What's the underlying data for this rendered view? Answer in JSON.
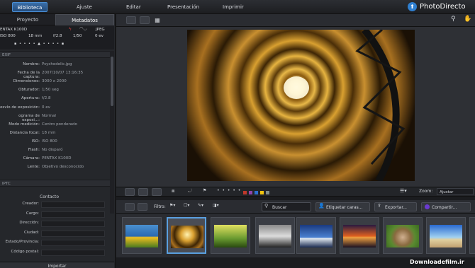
{
  "menu": {
    "biblioteca": "Biblioteca",
    "ajuste": "Ajuste",
    "editar": "Editar",
    "presentacion": "Presentación",
    "imprimir": "Imprimir"
  },
  "brand": {
    "name": "PhotoDirecto"
  },
  "left": {
    "tabs": {
      "proyecto": "Proyecto",
      "metadatos": "Metadatos"
    },
    "exifbar": {
      "camera": "ENTAX K100D",
      "format": "JPEG",
      "iso": "ISO 800",
      "focal": "18 mm",
      "aperture": "f/2.8",
      "shutter": "1/50",
      "ev": "0 ev"
    },
    "exif_title": "EXIF",
    "exif": [
      {
        "k": "Nombre:",
        "v": "Psychedelic.jpg"
      },
      {
        "k": "Fecha de la captura:",
        "v": "2007/10/07 13:16:35"
      },
      {
        "k": "Dimensiones:",
        "v": "3000 x 2000"
      },
      {
        "k": "Obturador:",
        "v": "1/50 seg"
      },
      {
        "k": "Apertura:",
        "v": "f/2.8"
      },
      {
        "k": "esvío de exposición:",
        "v": "0 ev"
      },
      {
        "k": "ograma de exposi...:",
        "v": "Normal"
      },
      {
        "k": "Modo medición:",
        "v": "Centro ponderado"
      },
      {
        "k": "Distancia focal:",
        "v": "18 mm"
      },
      {
        "k": "ISO:",
        "v": "ISO 800"
      },
      {
        "k": "Flash:",
        "v": "No disparó"
      },
      {
        "k": "Cámara:",
        "v": "PENTAX K100D"
      },
      {
        "k": "Lente:",
        "v": "Objetivo desconocido"
      }
    ],
    "iptc_title": "IPTC",
    "contacto": "Contacto",
    "iptc": [
      "Creador:",
      "Cargo:",
      "Dirección:",
      "Ciudad:",
      "Estado/Provincia:",
      "Código postal:"
    ],
    "import": "Importar"
  },
  "toolbar": {
    "zoom_label": "Zoom:",
    "zoom_value": "Ajustar",
    "filtro": "Filtro:",
    "buscar": "Buscar",
    "etiquetar": "Etiquetar caras...",
    "exportar": "Exportar...",
    "compartir": "Compartir..."
  },
  "colors": {
    "accent": "#4a8fd6",
    "labels": [
      "#c0392b",
      "#8e44ad",
      "#2c6fd1",
      "#f1c40f",
      "#7f8c8d"
    ]
  },
  "watermark": "Downloadefilm.ir"
}
